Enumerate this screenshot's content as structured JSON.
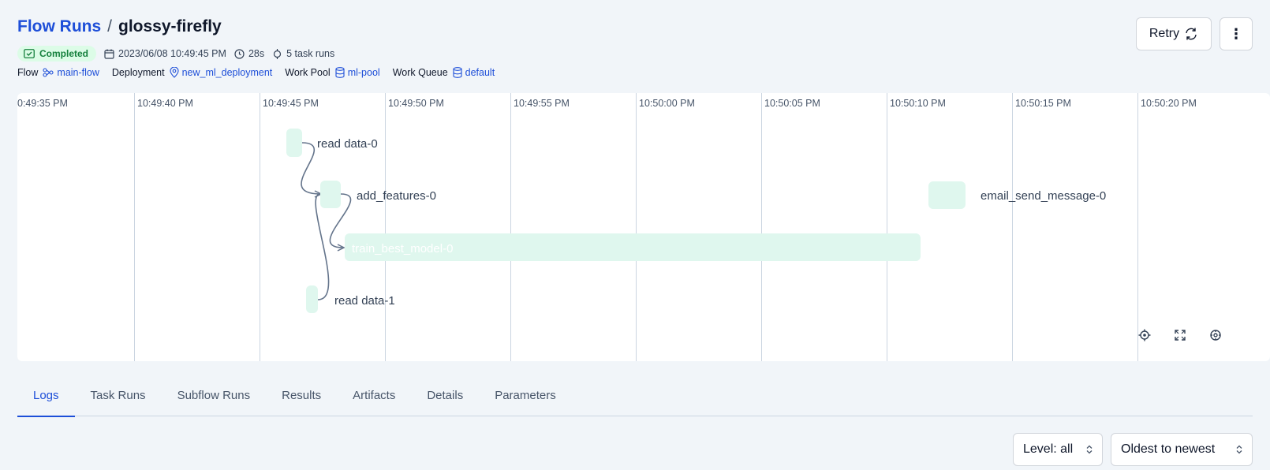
{
  "breadcrumb": {
    "parent": "Flow Runs",
    "separator": "/",
    "current": "glossy-firefly"
  },
  "status": {
    "label": "Completed",
    "color": "#15803d"
  },
  "meta": {
    "start_time": "2023/06/08 10:49:45 PM",
    "duration": "28s",
    "task_runs": "5 task runs"
  },
  "details": {
    "flow": {
      "label": "Flow",
      "value": "main-flow"
    },
    "deployment": {
      "label": "Deployment",
      "value": "new_ml_deployment"
    },
    "work_pool": {
      "label": "Work Pool",
      "value": "ml-pool"
    },
    "work_queue": {
      "label": "Work Queue",
      "value": "default"
    }
  },
  "actions": {
    "retry_label": "Retry",
    "more_label": "⋮"
  },
  "timeline": {
    "ticks": [
      "0:49:35 PM",
      "10:49:40 PM",
      "10:49:45 PM",
      "10:49:50 PM",
      "10:49:55 PM",
      "10:50:00 PM",
      "10:50:05 PM",
      "10:50:10 PM",
      "10:50:15 PM",
      "10:50:20 PM"
    ],
    "nodes": [
      "read data-0",
      "add_features-0",
      "train_best_model-0",
      "read data-1",
      "email_send_message-0"
    ]
  },
  "tabs": [
    "Logs",
    "Task Runs",
    "Subflow Runs",
    "Results",
    "Artifacts",
    "Details",
    "Parameters"
  ],
  "active_tab": "Logs",
  "filters": {
    "level": "Level: all",
    "order": "Oldest to newest"
  },
  "colors": {
    "accent": "#1d4ed8",
    "node_fill": "#dff7ee",
    "completed_bg": "#dcfce7"
  }
}
